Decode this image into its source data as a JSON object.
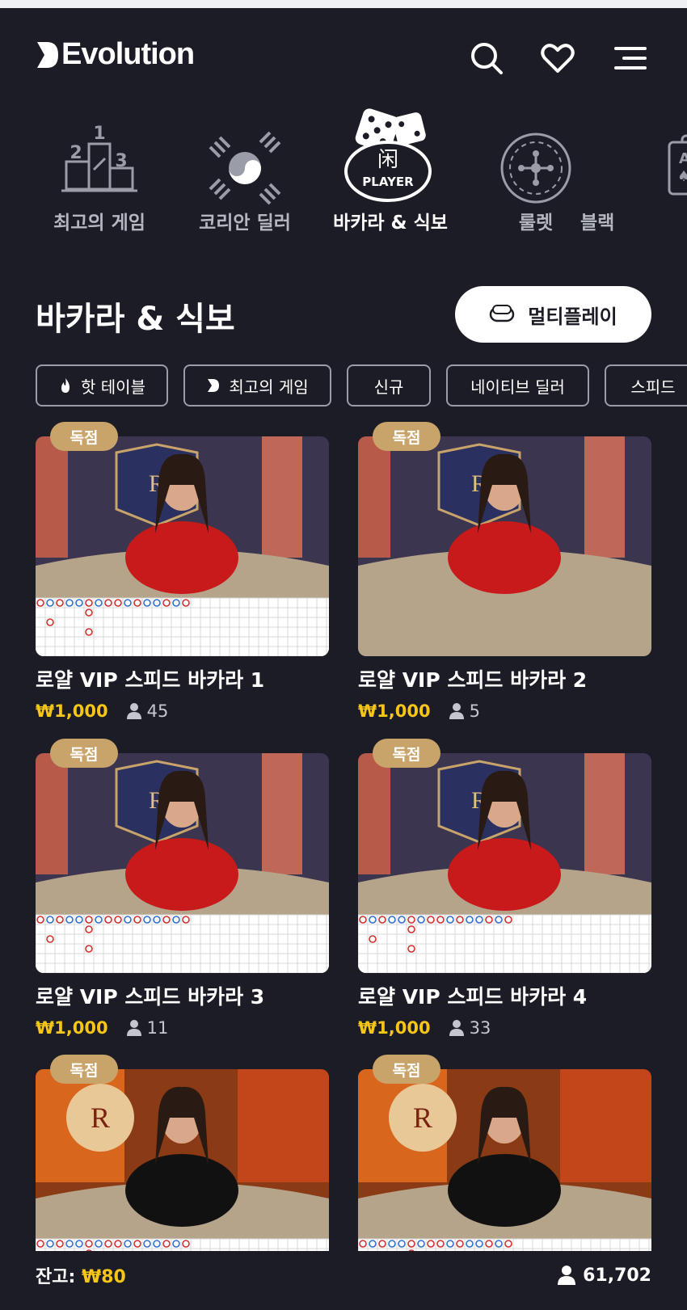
{
  "header": {
    "brand": "Evolution",
    "icons": [
      "search-icon",
      "heart-icon",
      "menu-icon"
    ]
  },
  "categories": [
    {
      "label": "최고의 게임",
      "icon": "podium-icon",
      "active": false
    },
    {
      "label": "코리안 딜러",
      "icon": "taegeuk-icon",
      "active": false
    },
    {
      "label": "바카라 & 식보",
      "icon": "dice-player-icon",
      "icon_text": "PLAYER",
      "icon_glyph": "闲",
      "active": true
    },
    {
      "label": "룰렛",
      "icon": "roulette-icon",
      "active": false
    },
    {
      "label": "블랙",
      "icon": "cards-icon",
      "active": false
    }
  ],
  "section": {
    "title": "바카라 & 식보",
    "multiplay_label": "멀티플레이"
  },
  "chips": [
    {
      "label": "핫 테이블",
      "icon": "flame-icon"
    },
    {
      "label": "최고의 게임",
      "icon": "evolution-mark-icon"
    },
    {
      "label": "신규"
    },
    {
      "label": "네이티브 딜러"
    },
    {
      "label": "스피드"
    }
  ],
  "games": [
    {
      "badge": "독점",
      "title": "로얄 VIP 스피드 바카라 1",
      "price": "₩1,000",
      "players": "45",
      "scene": "red",
      "roadmap": true
    },
    {
      "badge": "독점",
      "title": "로얄 VIP 스피드 바카라 2",
      "price": "₩1,000",
      "players": "5",
      "scene": "red",
      "roadmap": false
    },
    {
      "badge": "독점",
      "title": "로얄 VIP 스피드 바카라 3",
      "price": "₩1,000",
      "players": "11",
      "scene": "red",
      "roadmap": true
    },
    {
      "badge": "독점",
      "title": "로얄 VIP 스피드 바카라 4",
      "price": "₩1,000",
      "players": "33",
      "scene": "red",
      "roadmap": true
    },
    {
      "badge": "독점",
      "title": "",
      "price": "",
      "players": "",
      "scene": "orange",
      "roadmap": true
    },
    {
      "badge": "독점",
      "title": "",
      "price": "",
      "players": "",
      "scene": "orange",
      "roadmap": true
    }
  ],
  "footer": {
    "balance_label": "잔고:",
    "balance_value": "₩80",
    "online_count": "61,702"
  },
  "colors": {
    "background": "#1c1c26",
    "accent_gold": "#f5c518",
    "badge": "#c9a46a"
  }
}
